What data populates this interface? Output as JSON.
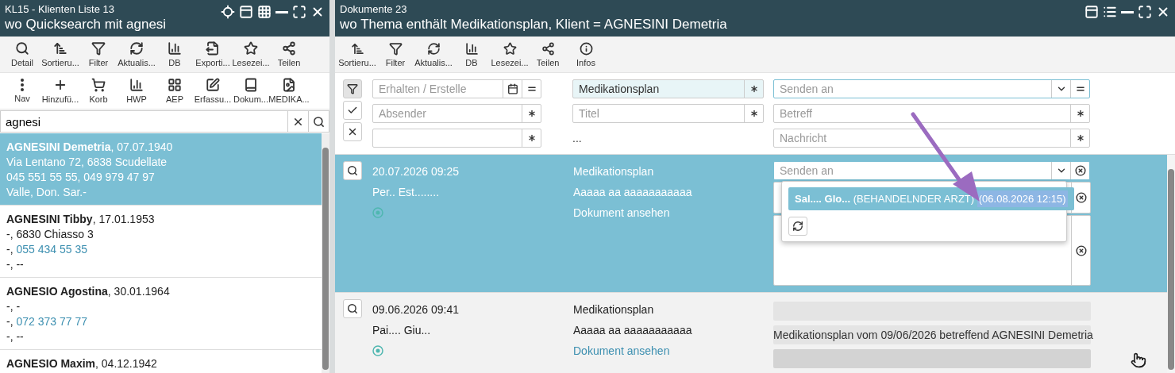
{
  "left_panel": {
    "title": "KL15 - Klienten Liste 13",
    "subtitle": "wo Quicksearch mit agnesi",
    "toolbar_1": [
      "Detail",
      "Sortieru...",
      "Filter",
      "Aktualis...",
      "DB",
      "Exporti...",
      "Lesezei...",
      "Teilen"
    ],
    "toolbar_2": [
      "Nav",
      "Hinzufü...",
      "Korb",
      "HWP",
      "AEP",
      "Erfassu...",
      "Dokum...",
      "MEDIKA..."
    ],
    "search": {
      "value": "agnesi"
    },
    "clients": [
      {
        "name": "AGNESINI Demetria",
        "birth": ", 07.07.1940",
        "address": "Via Lentano 72, 6838 Scudellate",
        "phone": "045 551 55 55, 049 979 47 97",
        "extra": "Valle, Don. Sar.-",
        "selected": true
      },
      {
        "name": "AGNESINI Tibby",
        "birth": ", 17.01.1953",
        "address": "-, 6830 Chiasso 3",
        "phone_prefix": "-,",
        "phone": "055 434 55 35",
        "extra": "-, --",
        "selected": false
      },
      {
        "name": "AGNESIO Agostina",
        "birth": ", 30.01.1964",
        "address": "-, -",
        "phone_prefix": "-,",
        "phone": "072 373 77 77",
        "extra": "-, --",
        "selected": false
      },
      {
        "name": "AGNESIO Maxim",
        "birth": ", 04.12.1942",
        "selected": false
      }
    ]
  },
  "right_panel": {
    "title": "Dokumente 23",
    "subtitle": "wo Thema enthält Medikationsplan, Klient = AGNESINI Demetria",
    "toolbar": [
      "Sortieru...",
      "Filter",
      "Aktualis...",
      "DB",
      "Lesezei...",
      "Teilen",
      "Infos"
    ],
    "filter_buttons": [
      {
        "selected": true
      },
      {
        "selected": false
      },
      {
        "selected": false
      }
    ],
    "filters": {
      "date": {
        "placeholder": "Erhalten / Erstelle"
      },
      "topic": {
        "value": "Medikationsplan"
      },
      "send_to": {
        "placeholder": "Senden an"
      },
      "sender": {
        "placeholder": "Absender"
      },
      "title": {
        "placeholder": "Titel"
      },
      "subject": {
        "placeholder": "Betreff"
      },
      "extra": {
        "kind": "field"
      },
      "more": "...",
      "message": {
        "placeholder": "Nachricht"
      }
    },
    "documents": [
      {
        "datetime": "20.07.2026 09:25",
        "person": "Per.. Est........",
        "topic": "Medikationsplan",
        "subtitle": "Aaaaa aa aaaaaaaaaaa",
        "link": "Dokument ansehen",
        "selected": true,
        "editor": {
          "send_to": {
            "placeholder": "Senden an"
          },
          "dropdown": {
            "option": {
              "name": "Sal.... Glo...",
              "role": "(BEHANDELNDER ARZT)",
              "date": "(06.08.2026 12:15)"
            }
          }
        }
      },
      {
        "datetime": "09.06.2026 09:41",
        "person": "Pai.... Giu...",
        "topic": "Medikationsplan",
        "subtitle": "Aaaaa aa aaaaaaaaaaa",
        "link": "Dokument ansehen",
        "selected": false,
        "fields": [
          {
            "kind": "empty"
          },
          {
            "kind": "text",
            "text": "Medikationsplan vom 09/06/2026 betreffend AGNESINI Demetria"
          },
          {
            "kind": "empty_dark"
          }
        ]
      }
    ]
  }
}
